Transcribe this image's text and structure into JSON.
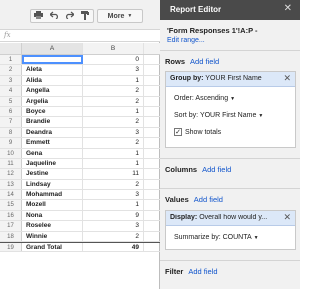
{
  "toolbar": {
    "print_icon": "printer-icon",
    "undo_icon": "undo-icon",
    "redo_icon": "redo-icon",
    "paint_icon": "paint-format-icon",
    "more_label": "More",
    "fx_label": "fx"
  },
  "sheet": {
    "columns": [
      "A",
      "B"
    ],
    "rows": [
      {
        "n": "1",
        "a": "",
        "b": "0"
      },
      {
        "n": "2",
        "a": "Aleta",
        "b": "3"
      },
      {
        "n": "3",
        "a": "Alida",
        "b": "1"
      },
      {
        "n": "4",
        "a": "Angella",
        "b": "2"
      },
      {
        "n": "5",
        "a": "Argelia",
        "b": "2"
      },
      {
        "n": "6",
        "a": "Boyce",
        "b": "1"
      },
      {
        "n": "7",
        "a": "Brandie",
        "b": "2"
      },
      {
        "n": "8",
        "a": "Deandra",
        "b": "3"
      },
      {
        "n": "9",
        "a": "Emmett",
        "b": "2"
      },
      {
        "n": "10",
        "a": "Gena",
        "b": "1"
      },
      {
        "n": "11",
        "a": "Jaqueline",
        "b": "1"
      },
      {
        "n": "12",
        "a": "Jestine",
        "b": "11"
      },
      {
        "n": "13",
        "a": "Lindsay",
        "b": "2"
      },
      {
        "n": "14",
        "a": "Mohammad",
        "b": "3"
      },
      {
        "n": "15",
        "a": "Mozell",
        "b": "1"
      },
      {
        "n": "16",
        "a": "Nona",
        "b": "9"
      },
      {
        "n": "17",
        "a": "Roselee",
        "b": "3"
      },
      {
        "n": "18",
        "a": "Winnie",
        "b": "2"
      },
      {
        "n": "19",
        "a": "Grand Total",
        "b": "49"
      }
    ]
  },
  "editor": {
    "title": "Report Editor",
    "close": "✕",
    "range_title": "'Form Responses 1'!A:P -",
    "edit_range": "Edit range...",
    "rows": {
      "label": "Rows",
      "add": "Add field",
      "group_prefix": "Group by:",
      "group_value": "YOUR First Name",
      "order": "Order: Ascending",
      "sort": "Sort by: YOUR First Name",
      "show_totals": "Show totals",
      "show_totals_checked": true
    },
    "columns": {
      "label": "Columns",
      "add": "Add field"
    },
    "values": {
      "label": "Values",
      "add": "Add field",
      "display_prefix": "Display:",
      "display_value": "Overall how would y...",
      "summarize": "Summarize by: COUNTA"
    },
    "filter": {
      "label": "Filter",
      "add": "Add field"
    }
  }
}
